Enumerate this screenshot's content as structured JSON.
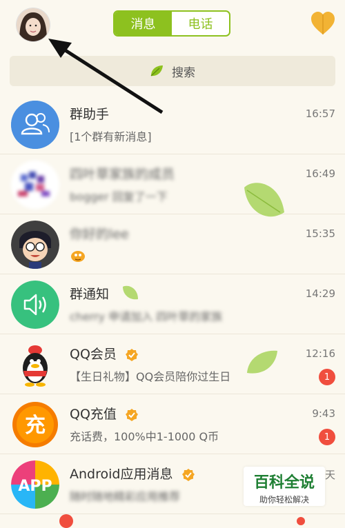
{
  "header": {
    "tabs": [
      {
        "label": "消息",
        "active": true
      },
      {
        "label": "电话",
        "active": false
      }
    ],
    "colors": {
      "accent": "#8dc11f",
      "heart": "#f2b334"
    }
  },
  "search": {
    "label": "搜索",
    "icon": "leaf-icon"
  },
  "conversations": [
    {
      "name": "群助手",
      "subtitle": "[1个群有新消息]",
      "time": "16:57",
      "icon": "group-assistant-icon"
    },
    {
      "name": "四叶草家族的成员",
      "subtitle": "bogger 回复了一下",
      "time": "16:49",
      "icon": "group-avatar"
    },
    {
      "name": "你好的lee",
      "subtitle": "",
      "time": "15:35",
      "icon": "cartoon-avatar"
    },
    {
      "name": "群通知",
      "subtitle": "cherry 申请加入 四叶草的家族",
      "time": "14:29",
      "icon": "speaker-icon"
    },
    {
      "name": "QQ会员",
      "subtitle": "【生日礼物】QQ会员陪你过生日",
      "time": "12:16",
      "badge": "1",
      "icon": "qq-penguin-icon"
    },
    {
      "name": "QQ充值",
      "subtitle": "充话费，100%中1-1000 Q币",
      "time": "9:43",
      "badge": "1",
      "icon": "recharge-icon"
    },
    {
      "name": "Android应用消息",
      "subtitle": "随时随地精彩应用推荐",
      "time": "天",
      "icon": "app-icon"
    }
  ],
  "watermark": {
    "title": "百科全说",
    "subtitle": "助你轻松解决"
  }
}
